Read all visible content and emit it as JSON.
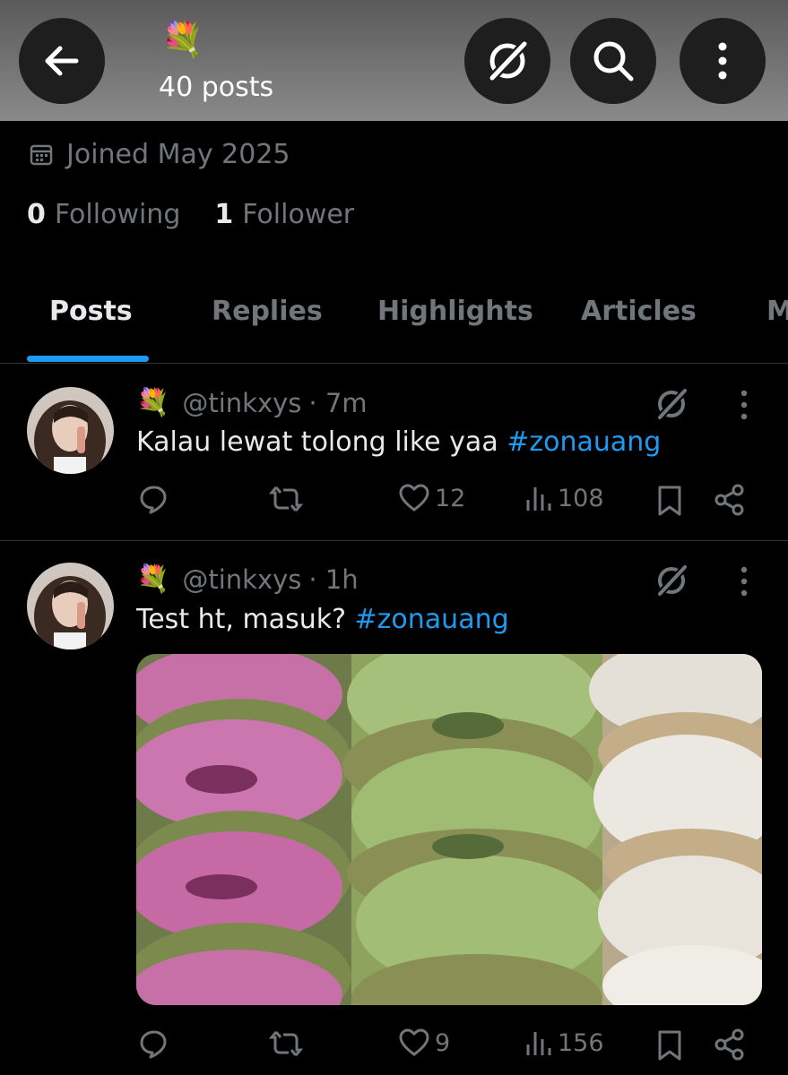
{
  "header": {
    "profile_emoji": "💐",
    "posts_count": "40 posts",
    "icons": [
      "back-arrow-icon",
      "grok-icon",
      "search-icon",
      "more-vertical-icon"
    ]
  },
  "profile": {
    "joined": "Joined May 2025",
    "following_count": "0",
    "following_label": "Following",
    "followers_count": "1",
    "followers_label": "Follower"
  },
  "tabs": [
    "Posts",
    "Replies",
    "Highlights",
    "Articles",
    "M"
  ],
  "active_tab": "Posts",
  "posts": [
    {
      "name_emoji": "💐",
      "handle": "@tinkxys",
      "time": "· 7m",
      "text": "Kalau lewat tolong like yaa ",
      "hashtag": "#zonauang",
      "likes": "12",
      "views": "108"
    },
    {
      "name_emoji": "💐",
      "handle": "@tinkxys",
      "time": "· 1h",
      "text": "Test ht, masuk? ",
      "hashtag": "#zonauang",
      "likes": "9",
      "views": "156",
      "media": "photo of rows of pink, green and white glazed donuts"
    }
  ],
  "colors": {
    "background": "#000000",
    "accent": "#1d9bf0",
    "muted_text": "#71767b",
    "primary_text": "#e7e9ea"
  }
}
